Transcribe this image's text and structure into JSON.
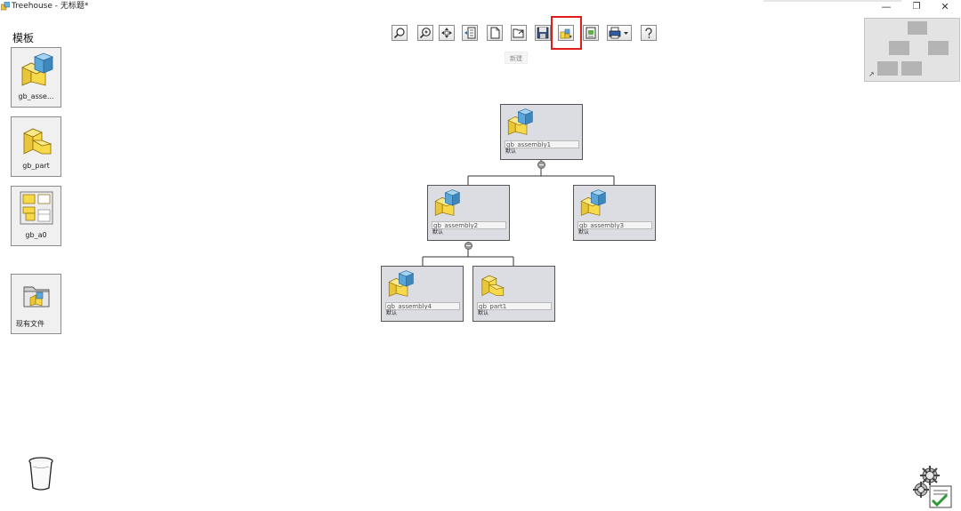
{
  "window": {
    "title": "Treehouse - 无标题*",
    "minimize": "—",
    "maximize": "❐",
    "close": "✕"
  },
  "templates": {
    "title": "模板",
    "items": [
      {
        "label": "gb_asse...",
        "icon": "assembly-icon"
      },
      {
        "label": "gb_part",
        "icon": "part-icon"
      },
      {
        "label": "gb_a0",
        "icon": "drawing-icon"
      },
      {
        "label": "现有文件",
        "icon": "existing-file-icon"
      }
    ]
  },
  "toolbar": {
    "buttons": [
      {
        "name": "zoom-fit",
        "icon": "zoom-icon"
      },
      {
        "name": "zoom-select",
        "icon": "zoom-select-icon"
      },
      {
        "name": "pan",
        "icon": "pan-icon"
      },
      {
        "name": "insert",
        "icon": "insert-icon"
      },
      {
        "name": "new",
        "icon": "new-document-icon"
      },
      {
        "name": "open",
        "icon": "open-folder-icon"
      },
      {
        "name": "save",
        "icon": "save-icon"
      },
      {
        "name": "create",
        "icon": "create-assembly-icon"
      },
      {
        "name": "export",
        "icon": "export-icon"
      },
      {
        "name": "print",
        "icon": "print-icon"
      },
      {
        "name": "help",
        "icon": "help-icon"
      }
    ],
    "tooltip": "新建",
    "highlight_color": "#e21b1b"
  },
  "tree": {
    "nodes": [
      {
        "id": "assembly1",
        "name": "gb_assembly1",
        "config": "默认",
        "type": "assembly"
      },
      {
        "id": "assembly2",
        "name": "gb_assembly2",
        "config": "默认",
        "type": "assembly"
      },
      {
        "id": "assembly3",
        "name": "gb_assembly3",
        "config": "默认",
        "type": "assembly"
      },
      {
        "id": "assembly4",
        "name": "gb_assembly4",
        "config": "默认",
        "type": "assembly"
      },
      {
        "id": "part1",
        "name": "gb_part1",
        "config": "默认",
        "type": "part"
      }
    ],
    "node_color": "#dcdde2"
  },
  "colors": {
    "part_yellow": "#f7d94a",
    "cube_blue": "#5ba6d8"
  }
}
